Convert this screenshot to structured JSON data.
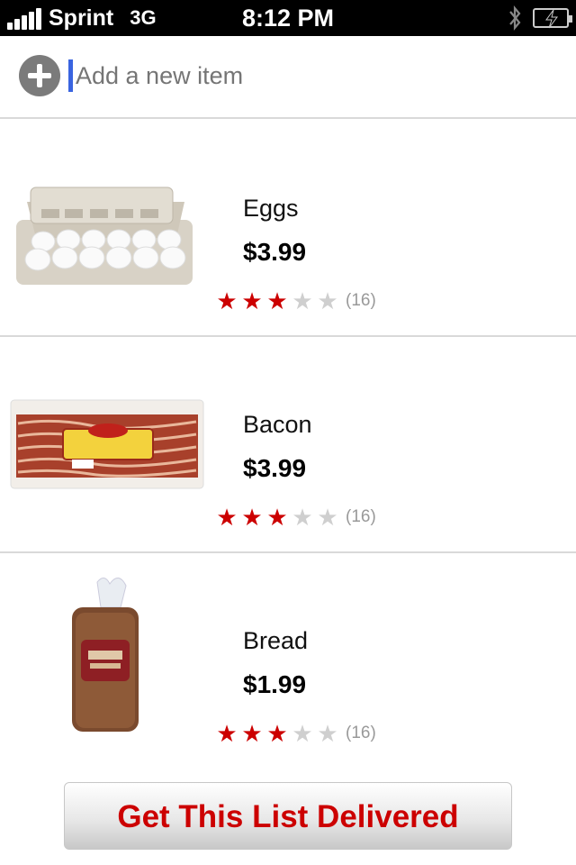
{
  "status_bar": {
    "carrier": "Sprint",
    "network": "3G",
    "time": "8:12 PM"
  },
  "add_item": {
    "placeholder": "Add a new item"
  },
  "items": [
    {
      "name": "Eggs",
      "price": "$3.99",
      "rating": 3,
      "max_rating": 5,
      "review_count": "(16)"
    },
    {
      "name": "Bacon",
      "price": "$3.99",
      "rating": 3,
      "max_rating": 5,
      "review_count": "(16)"
    },
    {
      "name": "Bread",
      "price": "$1.99",
      "rating": 3,
      "max_rating": 5,
      "review_count": "(16)"
    }
  ],
  "footer": {
    "deliver_label": "Get This List Delivered"
  },
  "colors": {
    "accent": "#cc0000",
    "cursor": "#3a64e0",
    "star_off": "#cfcfcf"
  },
  "icons": [
    "signal-icon",
    "bluetooth-icon",
    "battery-icon",
    "add-icon",
    "egg-carton-icon",
    "bacon-package-icon",
    "bread-loaf-icon",
    "star-icon"
  ]
}
